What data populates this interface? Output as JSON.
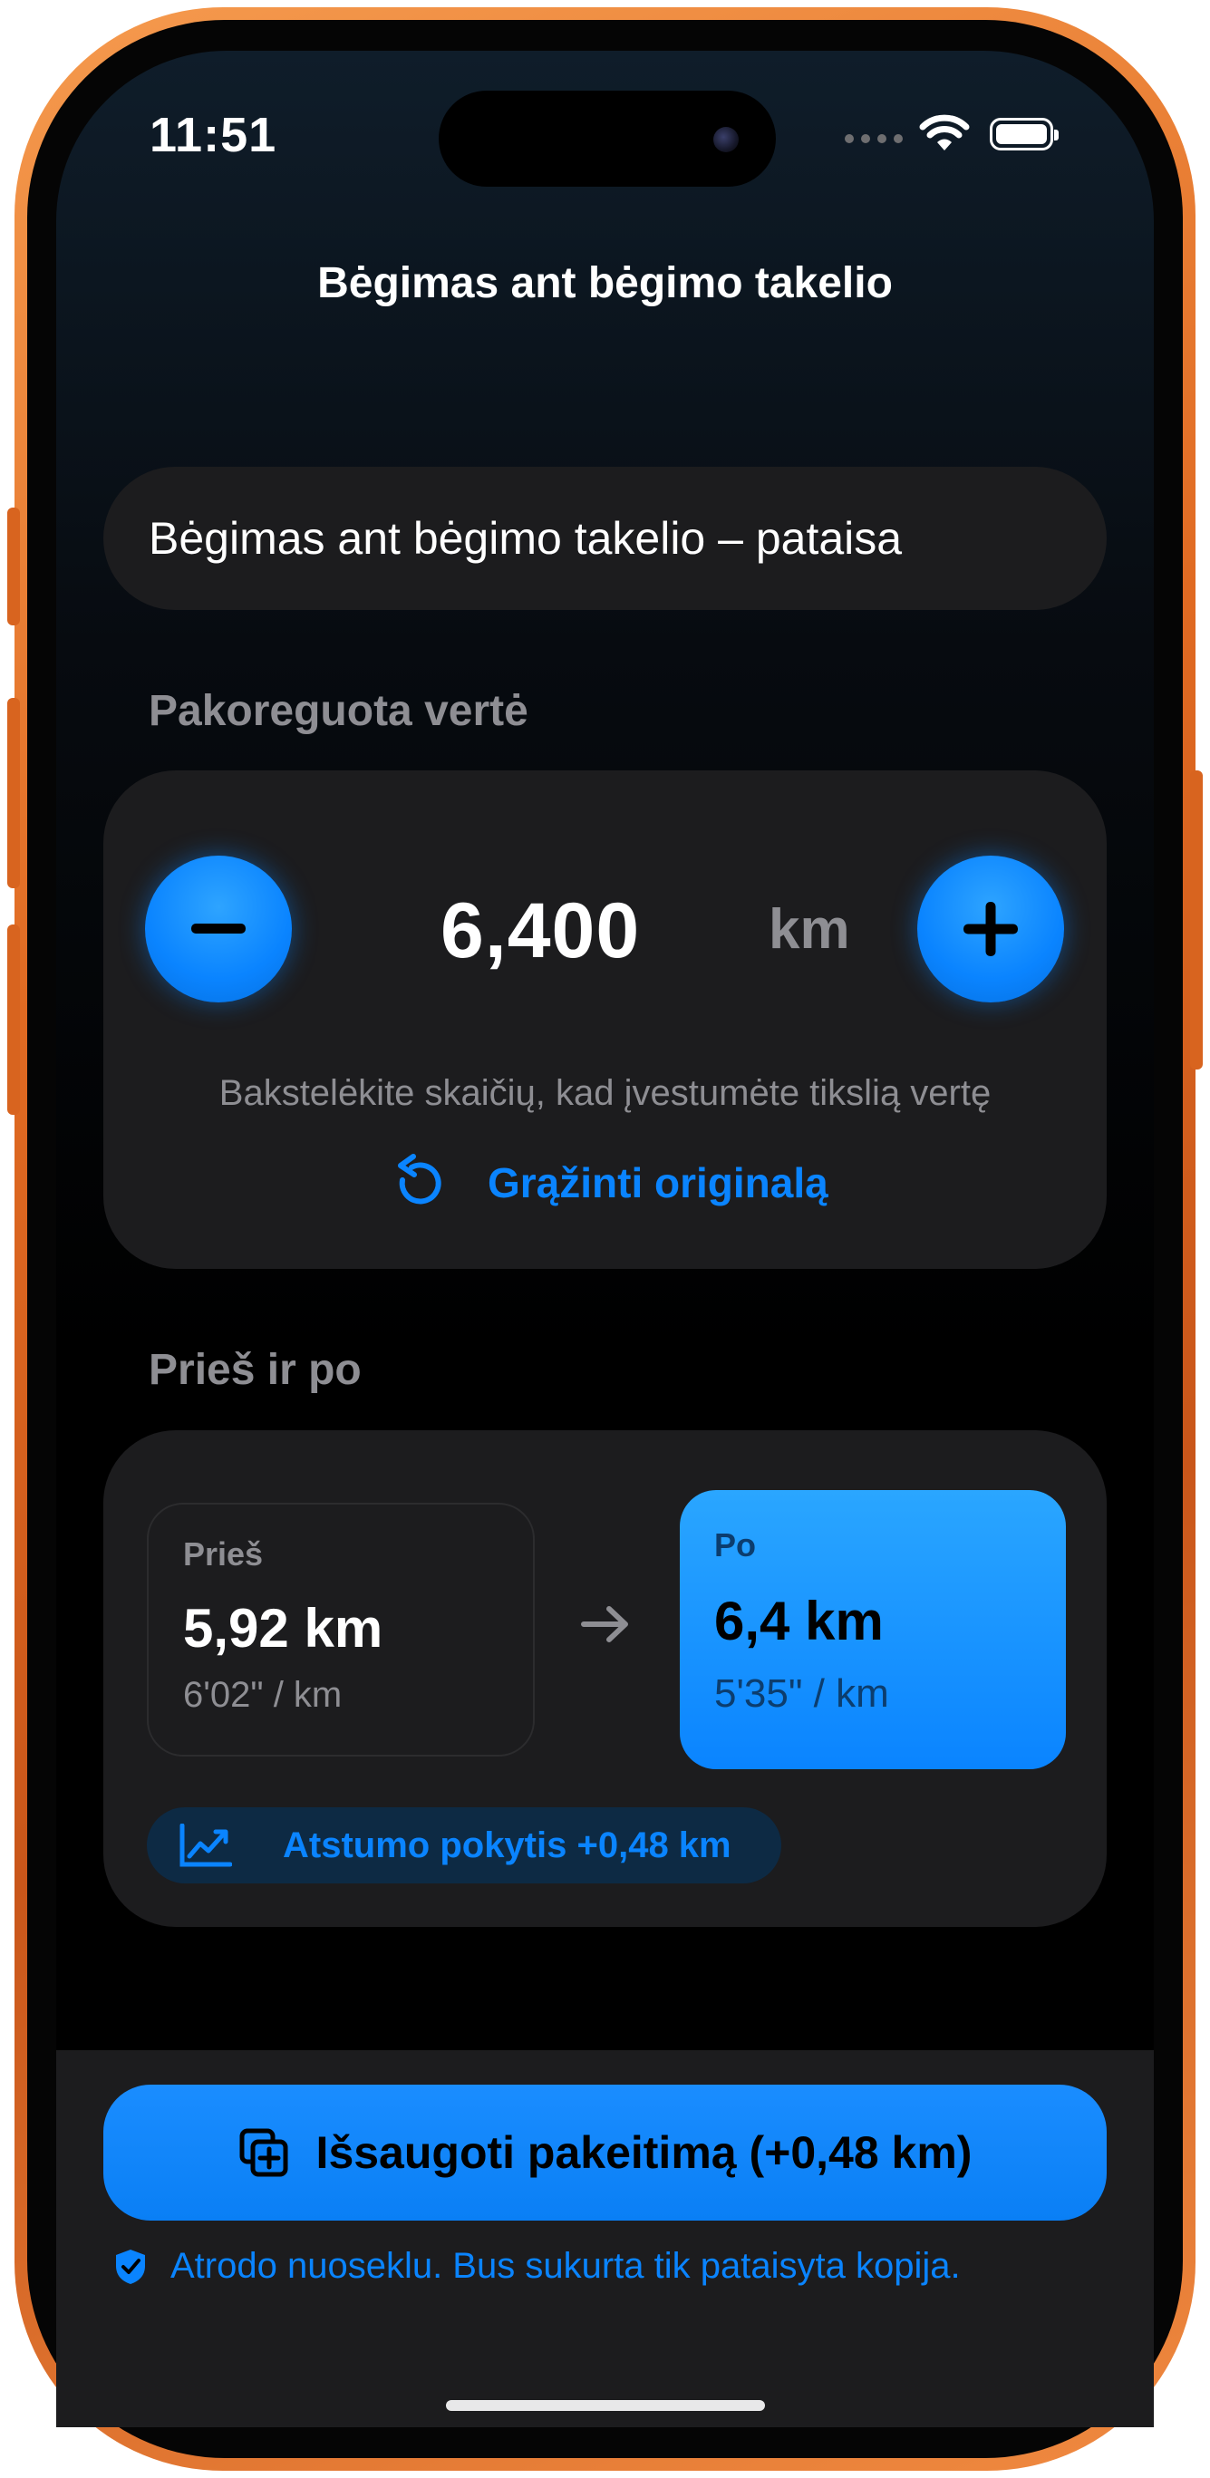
{
  "status_bar": {
    "time": "11:51"
  },
  "nav": {
    "title": "Bėgimas ant bėgimo takelio"
  },
  "name_field": {
    "value": "Bėgimas ant bėgimo takelio – pataisa"
  },
  "adjusted": {
    "section_label": "Pakoreguota vertė",
    "value": "6,400",
    "unit": "km",
    "hint": "Bakstelėkite skaičių, kad įvestumėte tikslią vertę",
    "reset_label": "Grąžinti originalą"
  },
  "comparison": {
    "section_label": "Prieš ir po",
    "before": {
      "label": "Prieš",
      "value": "5,92 km",
      "pace": "6'02\" / km"
    },
    "after": {
      "label": "Po",
      "value": "6,4 km",
      "pace": "5'35\" / km"
    },
    "delta_label": "Atstumo pokytis +0,48 km"
  },
  "footer": {
    "save_label": "Išsaugoti pakeitimą (+0,48 km)",
    "note": "Atrodo nuoseklu. Bus sukurta tik pataisyta kopija."
  },
  "colors": {
    "accent": "#0a84ff",
    "frame": "#e06a22",
    "card": "#1c1c1e"
  }
}
